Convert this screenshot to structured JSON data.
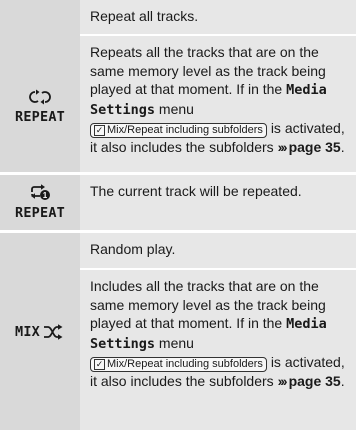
{
  "rows": [
    {
      "key": "REPEAT",
      "icon": "repeat-all-icon",
      "summary": "Repeat all tracks.",
      "desc_1": "Repeats all the tracks that are on the same memory level as the track being played at that moment. If in the",
      "menu_name": "Media Settings",
      "menu_word": "menu",
      "checkbox_label": "Mix/Repeat including subfolders",
      "desc_2": "is activated, it also includes the subfolders",
      "page_ref": "page 35",
      "end": "."
    },
    {
      "key": "REPEAT",
      "icon": "repeat-one-icon",
      "summary": "The current track will be repeated."
    },
    {
      "key": "MIX",
      "icon": "shuffle-icon",
      "summary": "Random play.",
      "desc_1": "Includes all the tracks that are on the same memory level as the track being played at that moment. If in the",
      "menu_name": "Media Settings",
      "menu_word": "menu",
      "checkbox_label": "Mix/Repeat including subfolders",
      "desc_2": "is activated, it also includes the subfolders",
      "page_ref": "page 35",
      "end": "."
    }
  ]
}
